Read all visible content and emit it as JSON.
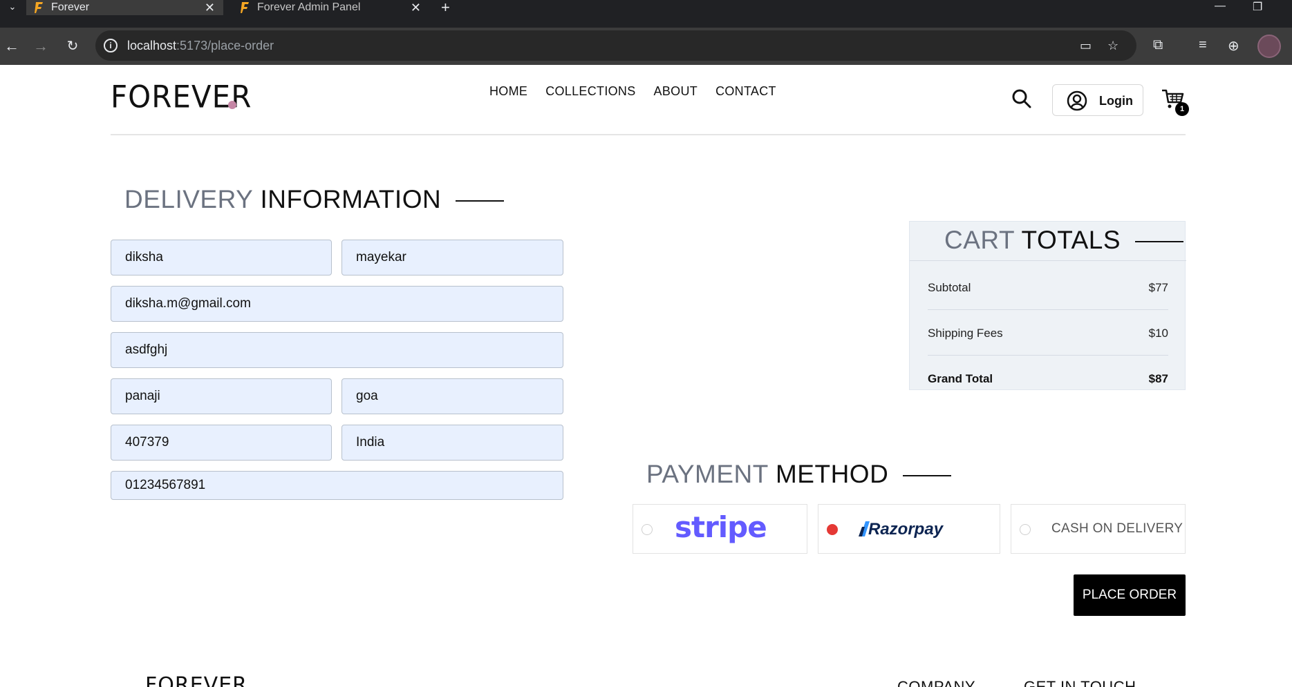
{
  "browser": {
    "tabs": [
      {
        "title": "Forever"
      },
      {
        "title": "Forever Admin Panel"
      }
    ],
    "url_host": "localhost",
    "url_path": ":5173/place-order"
  },
  "site": {
    "logo": "FOREVER",
    "nav": [
      "HOME",
      "COLLECTIONS",
      "ABOUT",
      "CONTACT"
    ],
    "login_label": "Login",
    "cart_count": "1"
  },
  "delivery": {
    "title_light": "DELIVERY",
    "title_dark": "INFORMATION",
    "first_name": "diksha",
    "last_name": "mayekar",
    "email": "diksha.m@gmail.com",
    "street": "asdfghj",
    "city": "panaji",
    "state": "goa",
    "zipcode": "407379",
    "country": "India",
    "phone": "01234567891"
  },
  "cart_totals": {
    "title_light": "CART",
    "title_dark": "TOTALS",
    "subtotal_label": "Subtotal",
    "subtotal_value": "$77",
    "shipping_label": "Shipping Fees",
    "shipping_value": "$10",
    "grand_label": "Grand Total",
    "grand_value": "$87"
  },
  "payment": {
    "title_light": "PAYMENT",
    "title_dark": "METHOD",
    "stripe": "stripe",
    "razorpay": "Razorpay",
    "cod": "CASH ON DELIVERY",
    "selected": "razorpay"
  },
  "place_order_label": "PLACE ORDER",
  "footer": {
    "logo": "FOREVER",
    "company_heading": "COMPANY",
    "contact_heading": "GET IN TOUCH"
  }
}
